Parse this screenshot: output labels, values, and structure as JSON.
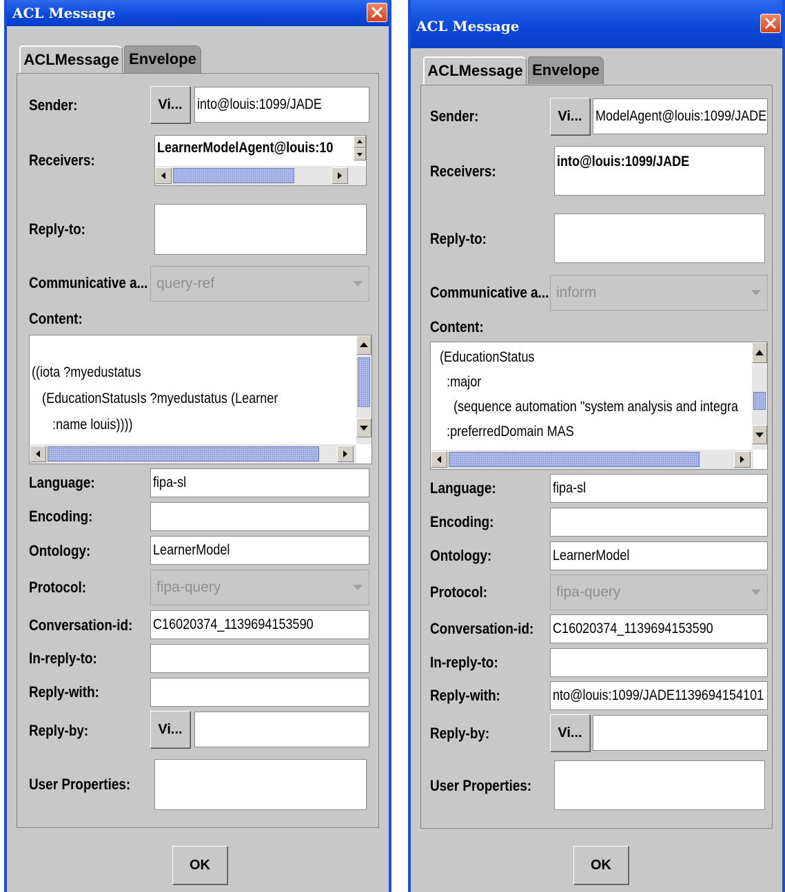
{
  "dialogs": [
    {
      "title": "ACL Message",
      "tabs": [
        "ACLMessage",
        "Envelope"
      ],
      "labels": {
        "sender": "Sender:",
        "receivers": "Receivers:",
        "reply_to": "Reply-to:",
        "communicative_act": "Communicative a...",
        "content": "Content:",
        "language": "Language:",
        "encoding": "Encoding:",
        "ontology": "Ontology:",
        "protocol": "Protocol:",
        "conversation_id": "Conversation-id:",
        "in_reply_to": "In-reply-to:",
        "reply_with": "Reply-with:",
        "reply_by": "Reply-by:",
        "user_properties": "User Properties:"
      },
      "view_label": "Vi...",
      "sender_value": "into@louis:1099/JADE",
      "receivers": [
        "LearnerModelAgent@louis:10"
      ],
      "communicative_act": "query-ref",
      "content_lines": [
        "",
        "((iota ?myedustatus",
        "   (EducationStatusIs ?myedustatus (Learner",
        "      :name louis))))"
      ],
      "language": "fipa-sl",
      "encoding": "",
      "ontology": "LearnerModel",
      "protocol": "fipa-query",
      "conversation_id": "C16020374_1139694153590",
      "in_reply_to": "",
      "reply_with": "",
      "reply_by": "",
      "ok_label": "OK"
    },
    {
      "title": "ACL Message",
      "tabs": [
        "ACLMessage",
        "Envelope"
      ],
      "labels": {
        "sender": "Sender:",
        "receivers": "Receivers:",
        "reply_to": "Reply-to:",
        "communicative_act": "Communicative a...",
        "content": "Content:",
        "language": "Language:",
        "encoding": "Encoding:",
        "ontology": "Ontology:",
        "protocol": "Protocol:",
        "conversation_id": "Conversation-id:",
        "in_reply_to": "In-reply-to:",
        "reply_with": "Reply-with:",
        "reply_by": "Reply-by:",
        "user_properties": "User Properties:"
      },
      "view_label": "Vi...",
      "sender_value": "ModelAgent@louis:1099/JADE",
      "receivers": [
        "into@louis:1099/JADE"
      ],
      "communicative_act": "inform",
      "content_lines": [
        "  (EducationStatus",
        "    :major",
        "      (sequence automation \"system analysis and integra",
        "    :preferredDomain MAS"
      ],
      "language": "fipa-sl",
      "encoding": "",
      "ontology": "LearnerModel",
      "protocol": "fipa-query",
      "conversation_id": "C16020374_1139694153590",
      "in_reply_to": "",
      "reply_with": "nto@louis:1099/JADE1139694154101",
      "reply_by": "",
      "ok_label": "OK"
    }
  ]
}
